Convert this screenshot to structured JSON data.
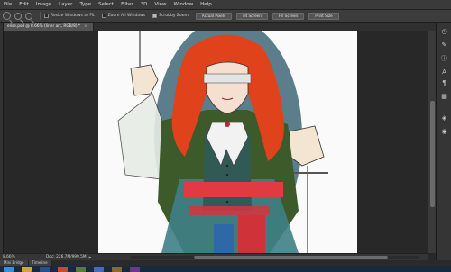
{
  "menubar": {
    "items": [
      "File",
      "Edit",
      "Image",
      "Layer",
      "Type",
      "Select",
      "Filter",
      "3D",
      "View",
      "Window",
      "Help"
    ]
  },
  "options_bar": {
    "tool_icon": "zoom-icon",
    "zoom_in_icon": "zoom-in-icon",
    "zoom_out_icon": "zoom-out-icon",
    "checks": [
      {
        "label": "Resize Windows to Fit",
        "checked": false
      },
      {
        "label": "Zoom All Windows",
        "checked": false
      },
      {
        "label": "Scrubby Zoom",
        "checked": true
      }
    ],
    "buttons": [
      "Actual Pixels",
      "Fit Screen",
      "Fill Screen",
      "Print Size"
    ]
  },
  "document": {
    "tab_title": "elise.psd @ 8.66% (liner art, RGB/8) *",
    "close_label": "×"
  },
  "status": {
    "zoom": "8.66%",
    "doc_info": "Doc: 226.7M/999.5M"
  },
  "bottom_tabs": [
    "Mini Bridge",
    "Timeline"
  ],
  "right_panel_icons": [
    "history-icon",
    "brush-presets-icon",
    "info-icon",
    "character-icon",
    "paragraph-icon",
    "swatches-icon",
    "layers-icon",
    "channels-icon"
  ],
  "taskbar_icons": [
    "start-icon",
    "explorer-icon",
    "photoshop-icon",
    "browser-icon",
    "media-icon",
    "mail-icon",
    "folder-icon",
    "app-icon"
  ],
  "colors": {
    "hair": "#e0431b",
    "jacket": "#3d5a2a",
    "teal": "#3f7f86",
    "sash": "#e23a43",
    "oval": "#3f6677",
    "accent_blue": "#2b63b3"
  }
}
